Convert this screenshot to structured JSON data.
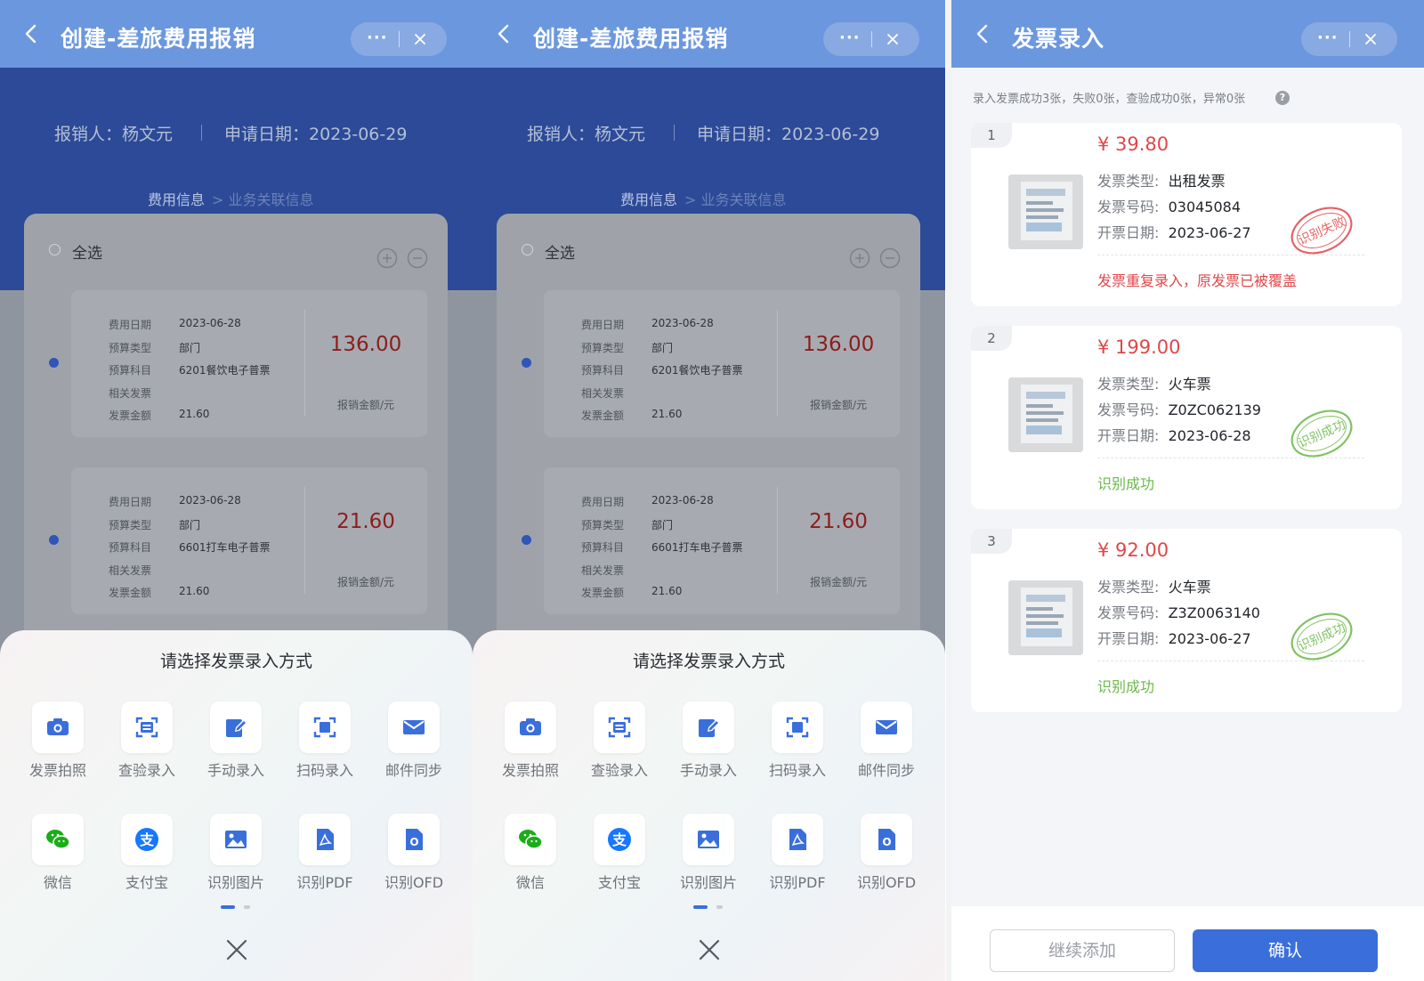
{
  "expense_panels": [
    {
      "title": "创建-差旅费用报销",
      "claimant": "报销人：杨文元",
      "apply_date": "申请日期：2023-06-29",
      "tab_info": "费用信息",
      "tab_link": "> 业务关联信息",
      "select_all": "全选",
      "items": [
        {
          "date_label": "费用日期",
          "date": "2023-06-28",
          "budget_type_label": "预算类型",
          "budget_type": "部门",
          "subject_label": "预算科目",
          "subject": "6201餐饮电子普票",
          "related_label": "相关发票",
          "invoice_amount_label": "发票金额",
          "invoice_amount": "21.60",
          "amount": "136.00",
          "amount_label": "报销金额/元"
        },
        {
          "date_label": "费用日期",
          "date": "2023-06-28",
          "budget_type_label": "预算类型",
          "budget_type": "部门",
          "subject_label": "预算科目",
          "subject": "6601打车电子普票",
          "related_label": "相关发票",
          "invoice_amount_label": "发票金额",
          "invoice_amount": "21.60",
          "amount": "21.60",
          "amount_label": "报销金额/元"
        }
      ],
      "sheet": {
        "title": "请选择发票录入方式",
        "methods": [
          {
            "label": "发票拍照",
            "icon": "camera-icon"
          },
          {
            "label": "查验录入",
            "icon": "scan-verify-icon"
          },
          {
            "label": "手动录入",
            "icon": "edit-icon"
          },
          {
            "label": "扫码录入",
            "icon": "qr-scan-icon"
          },
          {
            "label": "邮件同步",
            "icon": "mail-icon"
          },
          {
            "label": "微信",
            "icon": "wechat-icon"
          },
          {
            "label": "支付宝",
            "icon": "alipay-icon"
          },
          {
            "label": "识别图片",
            "icon": "image-icon"
          },
          {
            "label": "识别PDF",
            "icon": "pdf-icon"
          },
          {
            "label": "识别OFD",
            "icon": "ofd-icon"
          }
        ]
      }
    },
    {
      "title": "创建-差旅费用报销",
      "claimant": "报销人：杨文元",
      "apply_date": "申请日期：2023-06-29",
      "tab_info": "费用信息",
      "tab_link": "> 业务关联信息",
      "select_all": "全选",
      "items": [
        {
          "date_label": "费用日期",
          "date": "2023-06-28",
          "budget_type_label": "预算类型",
          "budget_type": "部门",
          "subject_label": "预算科目",
          "subject": "6201餐饮电子普票",
          "related_label": "相关发票",
          "invoice_amount_label": "发票金额",
          "invoice_amount": "21.60",
          "amount": "136.00",
          "amount_label": "报销金额/元"
        },
        {
          "date_label": "费用日期",
          "date": "2023-06-28",
          "budget_type_label": "预算类型",
          "budget_type": "部门",
          "subject_label": "预算科目",
          "subject": "6601打车电子普票",
          "related_label": "相关发票",
          "invoice_amount_label": "发票金额",
          "invoice_amount": "21.60",
          "amount": "21.60",
          "amount_label": "报销金额/元"
        }
      ],
      "sheet": {
        "title": "请选择发票录入方式",
        "methods": [
          {
            "label": "发票拍照",
            "icon": "camera-icon"
          },
          {
            "label": "查验录入",
            "icon": "scan-verify-icon"
          },
          {
            "label": "手动录入",
            "icon": "edit-icon"
          },
          {
            "label": "扫码录入",
            "icon": "qr-scan-icon"
          },
          {
            "label": "邮件同步",
            "icon": "mail-icon"
          },
          {
            "label": "微信",
            "icon": "wechat-icon"
          },
          {
            "label": "支付宝",
            "icon": "alipay-icon"
          },
          {
            "label": "识别图片",
            "icon": "image-icon"
          },
          {
            "label": "识别PDF",
            "icon": "pdf-icon"
          },
          {
            "label": "识别OFD",
            "icon": "ofd-icon"
          }
        ]
      }
    }
  ],
  "invoice_panel": {
    "title": "发票录入",
    "summary": "录入发票成功3张，失败0张，查验成功0张，异常0张",
    "invoices": [
      {
        "index": "1",
        "price": "¥ 39.80",
        "type_label": "发票类型:",
        "type": "出租发票",
        "code_label": "发票号码:",
        "code": "03045084",
        "date_label": "开票日期:",
        "date": "2023-06-27",
        "stamp": "识别失败",
        "status": "发票重复录入，原发票已被覆盖",
        "status_color": "#e0474a",
        "stamp_color": "#e0474a"
      },
      {
        "index": "2",
        "price": "¥ 199.00",
        "type_label": "发票类型:",
        "type": "火车票",
        "code_label": "发票号码:",
        "code": "Z0ZC062139",
        "date_label": "开票日期:",
        "date": "2023-06-28",
        "stamp": "识别成功",
        "status": "识别成功",
        "status_color": "#6bb84a",
        "stamp_color": "#6bb84a"
      },
      {
        "index": "3",
        "price": "¥ 92.00",
        "type_label": "发票类型:",
        "type": "火车票",
        "code_label": "发票号码:",
        "code": "Z3Z0063140",
        "date_label": "开票日期:",
        "date": "2023-06-27",
        "stamp": "识别成功",
        "status": "识别成功",
        "status_color": "#6bb84a",
        "stamp_color": "#6bb84a"
      }
    ],
    "continue_label": "继续添加",
    "confirm_label": "确认"
  },
  "colors": {
    "topbar": "#6b97de",
    "band": "#2c4a97",
    "amount_red": "#8c1d1d",
    "price_red": "#e0474a",
    "success_green": "#6bb84a",
    "primary_button": "#3a6fdb"
  }
}
